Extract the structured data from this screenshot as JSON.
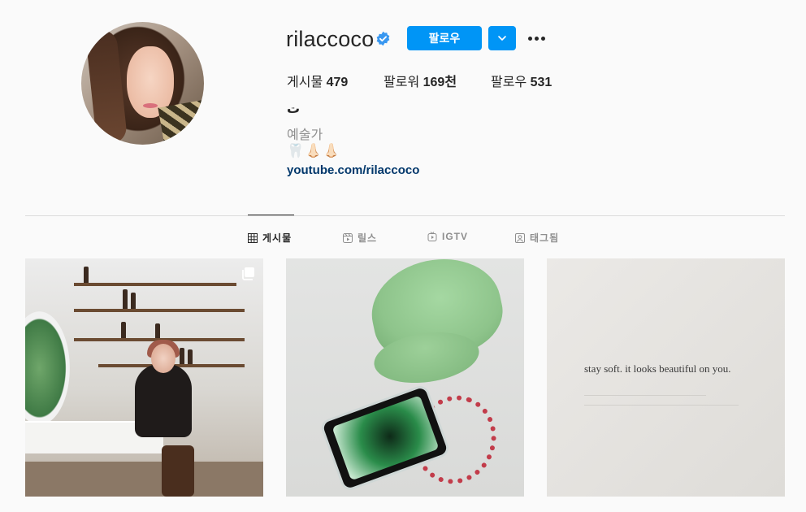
{
  "profile": {
    "username": "rilaccoco",
    "verified": true,
    "follow_label": "팔로우"
  },
  "stats": [
    {
      "label": "게시물",
      "value": "479"
    },
    {
      "label": "팔로워",
      "value": "169천"
    },
    {
      "label": "팔로우",
      "value": "531"
    }
  ],
  "bio": {
    "emoticon": "ت",
    "category": "예술가",
    "emojis": "🦷👃🏻👃🏻",
    "link": "youtube.com/rilaccoco"
  },
  "tabs": [
    {
      "label": "게시물",
      "active": true,
      "icon": "grid-icon"
    },
    {
      "label": "릴스",
      "active": false,
      "icon": "reels-icon"
    },
    {
      "label": "IGTV",
      "active": false,
      "icon": "igtv-icon"
    },
    {
      "label": "태그됨",
      "active": false,
      "icon": "tagged-icon"
    }
  ],
  "posts": [
    {
      "description_icon": "carousel-icon"
    },
    {},
    {
      "text": "stay soft. it looks beautiful on you."
    }
  ],
  "colors": {
    "accent": "#0095f6",
    "link": "#00376b",
    "muted": "#8e8e8e",
    "background": "#fafafa"
  }
}
